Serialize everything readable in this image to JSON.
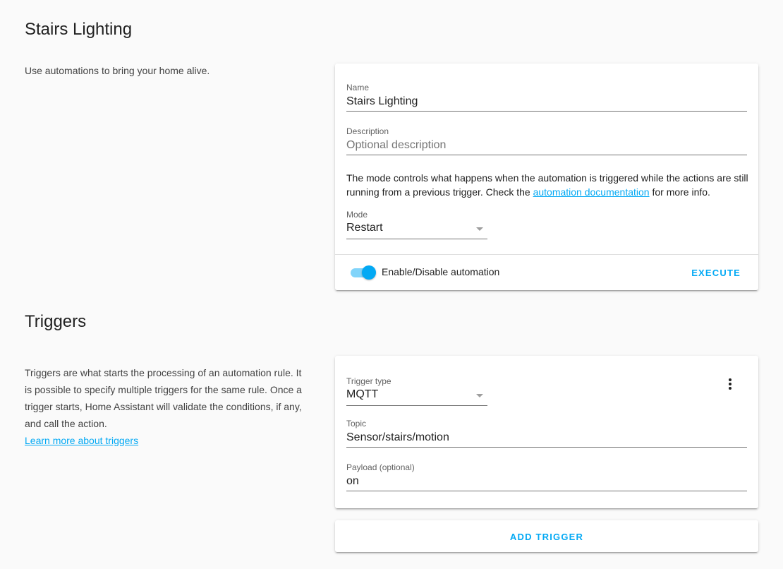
{
  "automation": {
    "title": "Stairs Lighting",
    "intro": "Use automations to bring your home alive.",
    "name_label": "Name",
    "name_value": "Stairs Lighting",
    "description_label": "Description",
    "description_placeholder": "Optional description",
    "mode_text_before": "The mode controls what happens when the automation is triggered while the actions are still running from a previous trigger. Check the ",
    "mode_link": "automation documentation",
    "mode_text_after": " for more info.",
    "mode_label": "Mode",
    "mode_value": "Restart",
    "toggle_label": "Enable/Disable automation",
    "toggle_on": true,
    "execute_label": "EXECUTE"
  },
  "triggers": {
    "title": "Triggers",
    "intro": "Triggers are what starts the processing of an automation rule. It is possible to specify multiple triggers for the same rule. Once a trigger starts, Home Assistant will validate the conditions, if any, and call the action.",
    "learn_more": "Learn more about triggers",
    "trigger_type_label": "Trigger type",
    "trigger_type_value": "MQTT",
    "topic_label": "Topic",
    "topic_value": "Sensor/stairs/motion",
    "payload_label": "Payload (optional)",
    "payload_value": "on",
    "add_trigger_label": "ADD TRIGGER"
  },
  "colors": {
    "accent": "#03a9f4",
    "background": "#fafafa"
  }
}
